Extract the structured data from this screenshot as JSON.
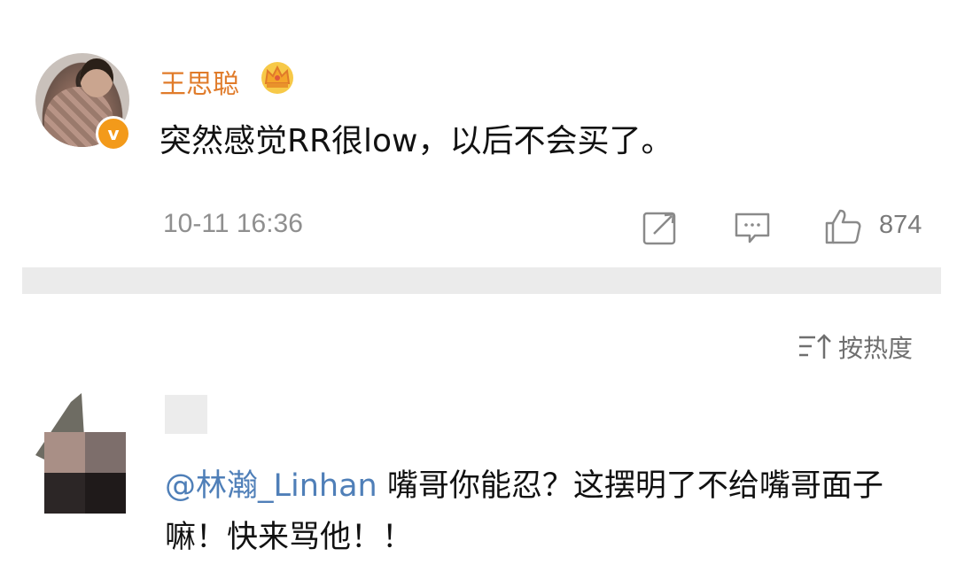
{
  "post": {
    "author": "王思聪",
    "badge_letter": "v",
    "text": "突然感觉RR很low，以后不会买了。",
    "timestamp": "10-11 16:36",
    "like_count": "874"
  },
  "comments_header": {
    "sort_label": "按热度"
  },
  "comment": {
    "mention": "@林瀚_Linhan",
    "text": " 嘴哥你能忍？这摆明了不给嘴哥面子嘛！快来骂他！！"
  },
  "colors": {
    "username": "#e07b2a",
    "mention": "#4f7fb8",
    "badge": "#f39a1a",
    "divider": "#ebebeb"
  },
  "icons": {
    "verified": "verified-badge-icon",
    "vip": "crown-icon",
    "repost": "repost-icon",
    "comment": "comment-icon",
    "like": "thumbs-up-icon",
    "sort": "sort-icon"
  }
}
